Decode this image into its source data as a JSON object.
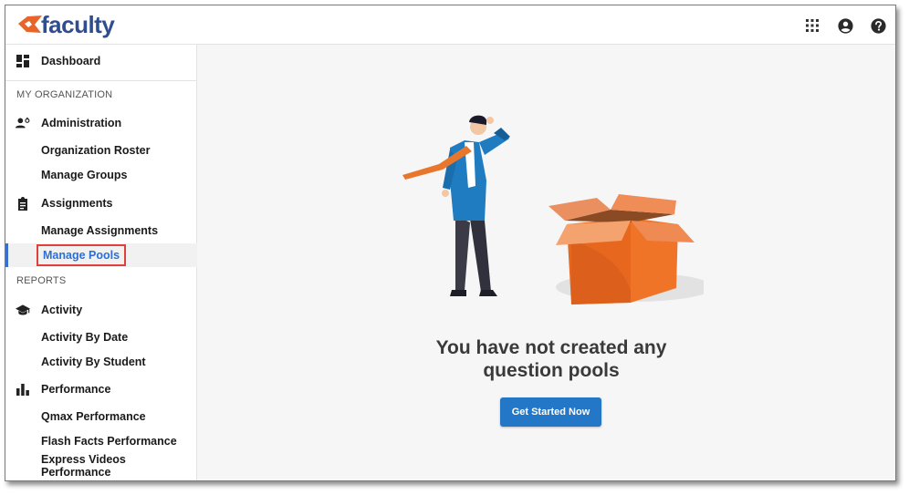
{
  "header": {
    "logo_text": "faculty",
    "icons": [
      "apps-grid-icon",
      "account-circle-icon",
      "help-circle-icon"
    ]
  },
  "sidebar": {
    "dashboard": "Dashboard",
    "section_org": "MY ORGANIZATION",
    "administration": "Administration",
    "organization_roster": "Organization Roster",
    "manage_groups": "Manage Groups",
    "assignments": "Assignments",
    "manage_assignments": "Manage Assignments",
    "manage_pools": "Manage Pools",
    "section_reports": "REPORTS",
    "activity": "Activity",
    "activity_by_date": "Activity By Date",
    "activity_by_student": "Activity By Student",
    "performance": "Performance",
    "qmax_performance": "Qmax Performance",
    "flash_facts_performance": "Flash Facts Performance",
    "express_videos_performance": "Express Videos Performance"
  },
  "main": {
    "empty_title_line1": "You have not created any",
    "empty_title_line2": "question pools",
    "cta_label": "Get Started Now"
  },
  "colors": {
    "brand_blue": "#2f4d8f",
    "brand_orange": "#e8652a",
    "active_link": "#2b6fd6",
    "cta": "#2476c7",
    "highlight_box": "#e0403b"
  }
}
